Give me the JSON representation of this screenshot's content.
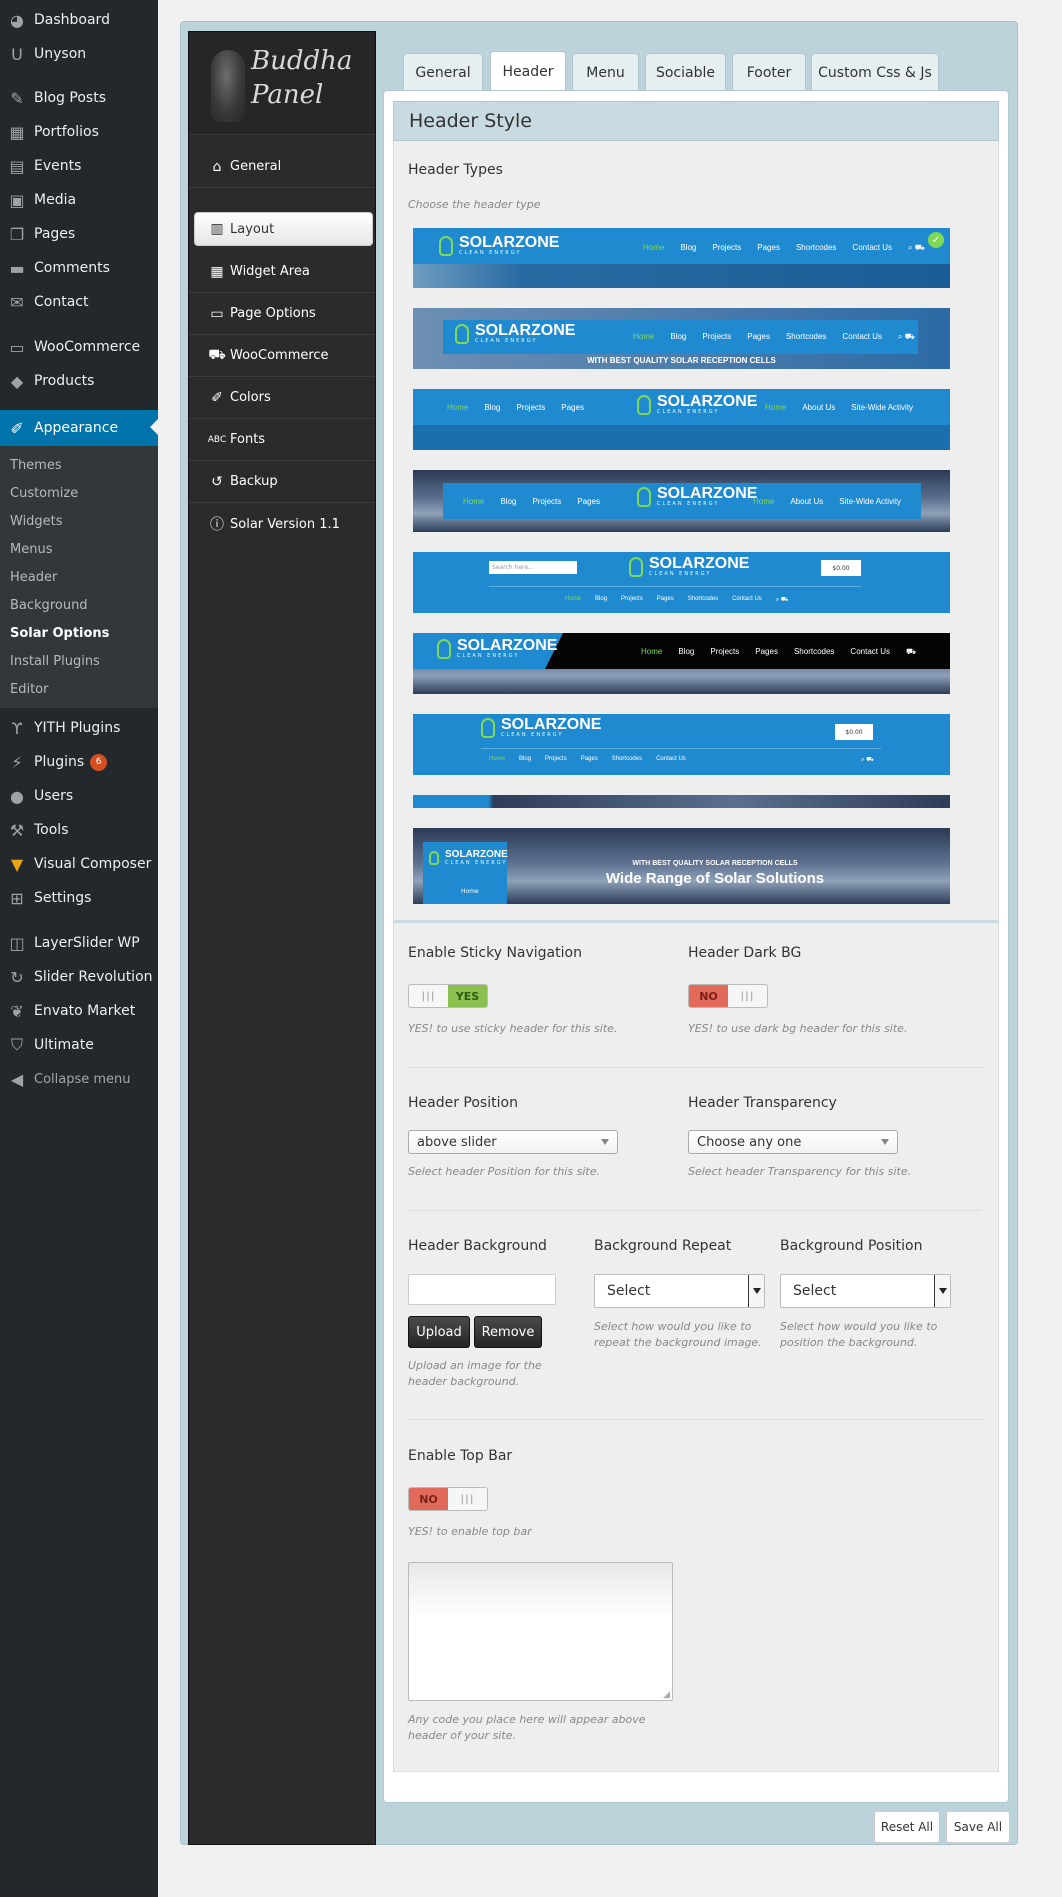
{
  "admin_menu": {
    "items": [
      {
        "label": "Dashboard",
        "icon": "dashboard-icon"
      },
      {
        "label": "Unyson",
        "icon": "unyson-icon"
      },
      {
        "label": "Blog Posts",
        "icon": "pin-icon"
      },
      {
        "label": "Portfolios",
        "icon": "portfolio-icon"
      },
      {
        "label": "Events",
        "icon": "calendar-icon"
      },
      {
        "label": "Media",
        "icon": "media-icon"
      },
      {
        "label": "Pages",
        "icon": "pages-icon"
      },
      {
        "label": "Comments",
        "icon": "comment-icon"
      },
      {
        "label": "Contact",
        "icon": "mail-icon"
      },
      {
        "label": "WooCommerce",
        "icon": "woo-icon"
      },
      {
        "label": "Products",
        "icon": "box-icon"
      },
      {
        "label": "Appearance",
        "icon": "brush-icon"
      },
      {
        "label": "YITH Plugins",
        "icon": "yith-icon"
      },
      {
        "label": "Plugins",
        "icon": "plugin-icon",
        "badge": "6"
      },
      {
        "label": "Users",
        "icon": "user-icon"
      },
      {
        "label": "Tools",
        "icon": "wrench-icon"
      },
      {
        "label": "Visual Composer",
        "icon": "vc-icon"
      },
      {
        "label": "Settings",
        "icon": "settings-icon"
      },
      {
        "label": "LayerSlider WP",
        "icon": "layers-icon"
      },
      {
        "label": "Slider Revolution",
        "icon": "refresh-icon"
      },
      {
        "label": "Envato Market",
        "icon": "leaf-icon"
      },
      {
        "label": "Ultimate",
        "icon": "shield-icon"
      },
      {
        "label": "Collapse menu",
        "icon": "collapse-icon"
      }
    ],
    "submenu": [
      "Themes",
      "Customize",
      "Widgets",
      "Menus",
      "Header",
      "Background",
      "Solar Options",
      "Install Plugins",
      "Editor"
    ]
  },
  "panel": {
    "logo_line1": "Buddha",
    "logo_line2": "Panel",
    "nav": [
      {
        "label": "General",
        "icon": "home-icon"
      },
      {
        "label": "Layout",
        "icon": "layout-icon"
      },
      {
        "label": "Widget Area",
        "icon": "widget-icon"
      },
      {
        "label": "Page Options",
        "icon": "page-icon"
      },
      {
        "label": "WooCommerce",
        "icon": "cart-icon"
      },
      {
        "label": "Colors",
        "icon": "brush-icon"
      },
      {
        "label": "Fonts",
        "icon": "fonts-icon"
      },
      {
        "label": "Backup",
        "icon": "history-icon"
      },
      {
        "label": "Solar Version 1.1",
        "icon": "info-icon"
      }
    ]
  },
  "tabs": [
    "General",
    "Header",
    "Menu",
    "Sociable",
    "Footer",
    "Custom Css & Js"
  ],
  "section": {
    "title": "Header Style",
    "header_types_label": "Header Types",
    "header_types_desc": "Choose the header type"
  },
  "thumb": {
    "brand": "SOLARZONE",
    "brand_sub": "CLEAN ENERGY",
    "nav_a": [
      "Home",
      "Blog",
      "Projects",
      "Pages",
      "Shortcodes",
      "Contact Us"
    ],
    "nav_b": [
      "Home",
      "Blog",
      "Projects",
      "Pages"
    ],
    "nav_c": [
      "Home",
      "About Us",
      "Site-Wide Activity"
    ],
    "tagline": "WITH BEST QUALITY SOLAR RECEPTION CELLS",
    "hero": "Wide Range of Solar Solutions",
    "search_ph": "Search here...",
    "cart": "$0.00"
  },
  "sticky": {
    "label": "Enable Sticky Navigation",
    "value": "YES",
    "desc": "YES! to use sticky header for this site."
  },
  "darkbg": {
    "label": "Header Dark BG",
    "value": "NO",
    "desc": "YES! to use dark bg header for this site."
  },
  "position": {
    "label": "Header Position",
    "value": "above slider",
    "desc": "Select header Position for this site."
  },
  "transparency": {
    "label": "Header Transparency",
    "value": "Choose any one",
    "desc": "Select header Transparency for this site."
  },
  "background": {
    "label": "Header Background",
    "upload": "Upload",
    "remove": "Remove",
    "desc": "Upload an image for the header background."
  },
  "bg_repeat": {
    "label": "Background Repeat",
    "value": "Select",
    "desc": "Select how would you like to repeat the background image."
  },
  "bg_position": {
    "label": "Background Position",
    "value": "Select",
    "desc": "Select how would you like to position the background."
  },
  "topbar": {
    "label": "Enable Top Bar",
    "value": "NO",
    "desc": "YES! to enable top bar",
    "code_desc": "Any code you place here will appear above header of your site."
  },
  "footer_buttons": {
    "reset": "Reset All",
    "save": "Save All"
  },
  "colors": {
    "wp_blue": "#0073aa",
    "toggle_yes": "#8cc152",
    "toggle_no": "#e26a5b",
    "thumb_blue": "#1f8ad0",
    "accent_green": "#7ed957"
  }
}
